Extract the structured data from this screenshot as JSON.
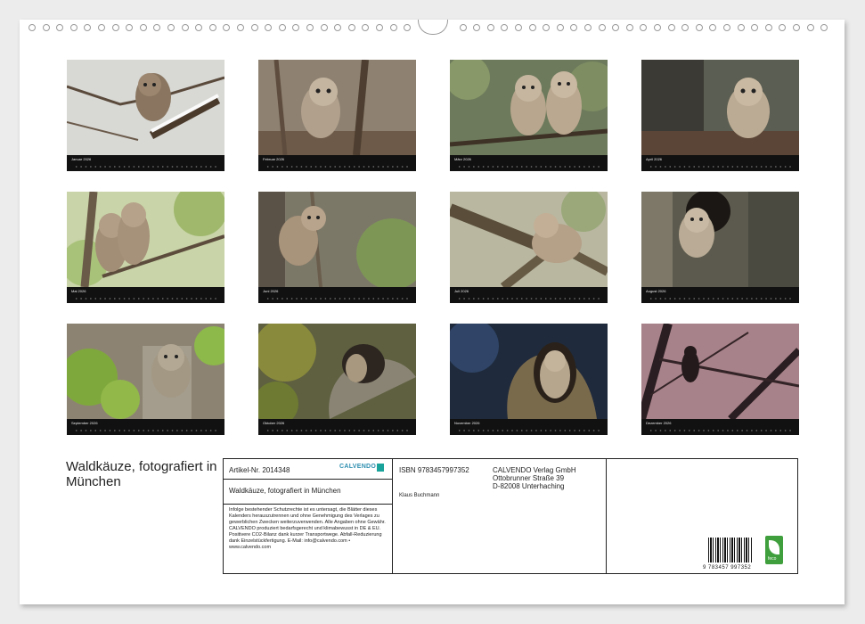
{
  "title": "Waldkäuze, fotografiert in München",
  "months": [
    "Januar 2026",
    "Februar 2026",
    "März 2026",
    "April 2026",
    "Mai 2026",
    "Juni 2026",
    "Juli 2026",
    "August 2026",
    "September 2026",
    "Oktober 2026",
    "November 2026",
    "Dezember 2026"
  ],
  "info": {
    "article": "Artikel-Nr. 2014348",
    "logo": "CALVENDO",
    "product_title": "Waldkäuze, fotografiert in München",
    "legal": "Infolge bestehender Schutzrechte ist es untersagt, die Blätter dieses Kalenders herauszutrennen und ohne Genehmigung des Verlages zu gewerblichen Zwecken weiterzuverwenden. Alle Angaben ohne Gewähr. CALVENDO produziert bedarfsgerecht und klimabewusst in DE & EU. Positivere CO2-Bilanz dank kurzer Transportwege. Abfall-Reduzierung dank Einzelstückfertigung. E-Mail: info@calvendo.com • www.calvendo.com",
    "isbn": "ISBN 9783457997352",
    "author": "Klaus Buchmann",
    "publisher_name": "CALVENDO Verlag GmbH",
    "publisher_street": "Ottobrunner Straße 39",
    "publisher_city": "D-82008 Unterhaching",
    "barcode_number": "9 783457 997352",
    "eco_label": "feco"
  },
  "colors": {
    "sheet": "#ffffff",
    "background": "#ececec",
    "strip": "#111111",
    "eco_green": "#3f9f3c"
  }
}
